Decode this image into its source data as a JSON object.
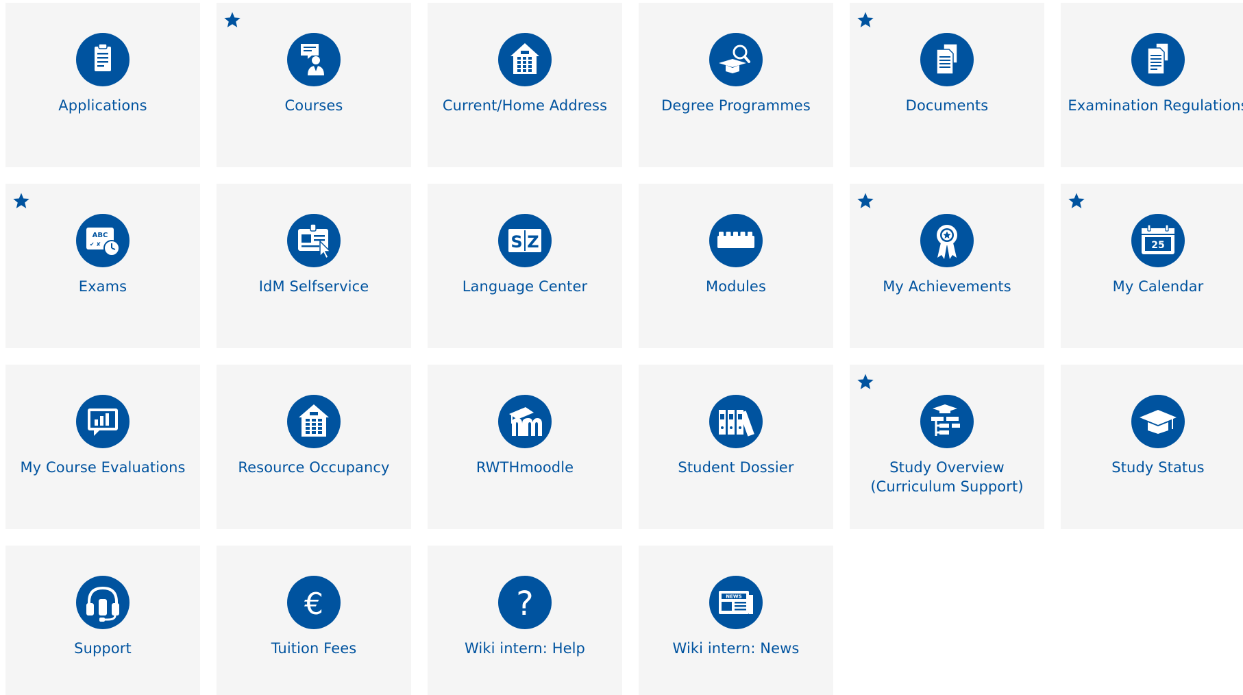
{
  "colors": {
    "accent": "#00539f",
    "tile_background": "#f5f5f5",
    "page_background": "#ffffff"
  },
  "tiles": [
    {
      "label": "Applications",
      "icon": "clipboard-icon",
      "starred": false
    },
    {
      "label": "Courses",
      "icon": "lecturer-icon",
      "starred": true
    },
    {
      "label": "Current/Home Address",
      "icon": "house-icon",
      "starred": false
    },
    {
      "label": "Degree Programmes",
      "icon": "graduation-search-icon",
      "starred": false
    },
    {
      "label": "Documents",
      "icon": "documents-icon",
      "starred": true
    },
    {
      "label": "Examination Regulations",
      "icon": "regulations-icon",
      "starred": false
    },
    {
      "label": "Exams",
      "icon": "exam-clock-icon",
      "starred": true
    },
    {
      "label": "IdM Selfservice",
      "icon": "id-card-icon",
      "starred": false
    },
    {
      "label": "Language Center",
      "icon": "sz-icon",
      "starred": false
    },
    {
      "label": "Modules",
      "icon": "building-block-icon",
      "starred": false
    },
    {
      "label": "My Achievements",
      "icon": "award-ribbon-icon",
      "starred": true
    },
    {
      "label": "My Calendar",
      "icon": "calendar-icon",
      "starred": true,
      "icon_text": "25"
    },
    {
      "label": "My Course Evaluations",
      "icon": "chart-bubble-icon",
      "starred": false
    },
    {
      "label": "Resource Occupancy",
      "icon": "building-icon",
      "starred": false
    },
    {
      "label": "RWTHmoodle",
      "icon": "moodle-icon",
      "starred": false
    },
    {
      "label": "Student Dossier",
      "icon": "binders-icon",
      "starred": false
    },
    {
      "label": "Study Overview (Curriculum Support)",
      "icon": "curriculum-tree-icon",
      "starred": true
    },
    {
      "label": "Study Status",
      "icon": "mortarboard-icon",
      "starred": false
    },
    {
      "label": "Support",
      "icon": "headset-icon",
      "starred": false
    },
    {
      "label": "Tuition Fees",
      "icon": "euro-icon",
      "starred": false
    },
    {
      "label": "Wiki intern: Help",
      "icon": "question-icon",
      "starred": false
    },
    {
      "label": "Wiki intern: News",
      "icon": "newspaper-icon",
      "starred": false,
      "icon_text": "NEWS"
    }
  ]
}
